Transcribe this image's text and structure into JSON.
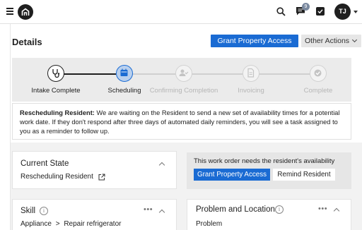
{
  "header": {
    "menu_icon": "hamburger-menu-icon",
    "logo_icon": "home-logo-icon",
    "search_icon": "search-icon",
    "messages_icon": "chat-bubble-icon",
    "messages_badge": "9",
    "tasks_icon": "checkbox-icon",
    "avatar_initials": "TJ"
  },
  "page": {
    "title": "Details",
    "grant_access_label": "Grant Property Access",
    "other_actions_label": "Other Actions"
  },
  "stepper": {
    "steps": [
      {
        "label": "Intake Complete",
        "icon": "stethoscope-icon",
        "state": "done"
      },
      {
        "label": "Scheduling",
        "icon": "calendar-icon",
        "state": "current"
      },
      {
        "label": "Confirming Completion",
        "icon": "user-check-icon",
        "state": "pending"
      },
      {
        "label": "Invoicing",
        "icon": "document-icon",
        "state": "pending"
      },
      {
        "label": "Complete",
        "icon": "check-circle-icon",
        "state": "pending"
      }
    ]
  },
  "notice": {
    "heading": "Rescheduling Resident:",
    "body": "We are waiting on the Resident to send a new set of availability times for a potential work date. If they don't respond after three days of automated daily reminders, you will see a task assigned to you as a reminder to follow up."
  },
  "current_state": {
    "title": "Current State",
    "value": "Rescheduling Resident"
  },
  "availability": {
    "text": "This work order needs the resident's availability",
    "grant_label": "Grant Property Access",
    "remind_label": "Remind Resident"
  },
  "skill": {
    "title": "Skill",
    "category": "Appliance",
    "separator": ">",
    "subcategory": "Repair refrigerator"
  },
  "problem": {
    "title": "Problem and Location",
    "subheading": "Problem"
  },
  "colors": {
    "primary": "#1a6bd3",
    "dark": "#1f1f1f",
    "muted": "#c4c4c4"
  }
}
